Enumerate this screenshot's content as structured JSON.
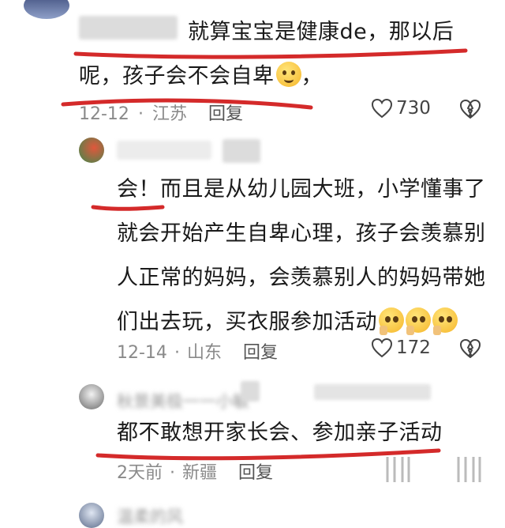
{
  "comments": [
    {
      "username": "",
      "text_line1": "就算宝宝是健康de，那以后",
      "text_line2": "呢，孩子会不会自卑",
      "text_line2_tail": "，",
      "date": "12-12",
      "location": "江苏",
      "reply": "回复",
      "likes": "730"
    },
    {
      "username": "",
      "lines": [
        "会！而且是从幼儿园大班，小学懂事了",
        "就会开始产生自卑心理，孩子会羡慕别",
        "人正常的妈妈，会羡慕别人的妈妈带她",
        "们出去玩，买衣服参加活动"
      ],
      "date": "12-14",
      "location": "山东",
      "reply": "回复",
      "likes": "172"
    },
    {
      "username": "秋景美极一一小敏",
      "text": "都不敢想开家长会、参加亲子活动",
      "date": "2天前",
      "location": "新疆",
      "reply": "回复"
    },
    {
      "username": "温柔的风"
    }
  ],
  "colors": {
    "underline": "#d42a2a",
    "meta": "#8a8a8a",
    "icon": "#444444"
  },
  "icons": [
    "heart-outline-icon",
    "broken-heart-icon",
    "laughing-tears-emoji",
    "pleading-face-emoji"
  ]
}
